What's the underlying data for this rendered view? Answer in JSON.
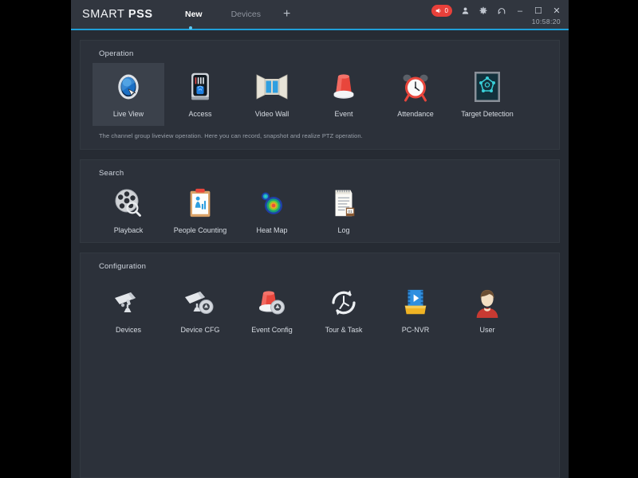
{
  "window": {
    "brand_thin": "SMART",
    "brand_bold": "PSS",
    "clock": "10:58:20",
    "alarm_count": "0",
    "icons": {
      "alarm": "speaker-alarm-icon",
      "user": "user-icon",
      "settings": "gear-icon",
      "help": "help-icon",
      "minimize": "minimize-icon",
      "maximize": "maximize-icon",
      "close": "close-icon"
    },
    "minimize_label": "–",
    "maximize_label": "☐",
    "close_label": "✕",
    "accent_color": "#1f9fd8"
  },
  "tabs": [
    {
      "label": "New",
      "active": true
    },
    {
      "label": "Devices",
      "active": false
    }
  ],
  "tab_add_label": "+",
  "panels": [
    {
      "title": "Operation",
      "description": "The channel group liveview operation. Here you can record, snapshot and realize PTZ operation.",
      "items": [
        {
          "label": "Live View",
          "icon": "dome-camera-icon",
          "selected": true
        },
        {
          "label": "Access",
          "icon": "access-terminal-icon",
          "selected": false
        },
        {
          "label": "Video Wall",
          "icon": "video-wall-icon",
          "selected": false
        },
        {
          "label": "Event",
          "icon": "siren-icon",
          "selected": false
        },
        {
          "label": "Attendance",
          "icon": "alarm-clock-icon",
          "selected": false
        },
        {
          "label": "Target Detection",
          "icon": "target-detection-icon",
          "selected": false
        }
      ]
    },
    {
      "title": "Search",
      "description": "",
      "items": [
        {
          "label": "Playback",
          "icon": "film-reel-search-icon",
          "selected": false
        },
        {
          "label": "People Counting",
          "icon": "clipboard-people-icon",
          "selected": false
        },
        {
          "label": "Heat Map",
          "icon": "heat-map-icon",
          "selected": false
        },
        {
          "label": "Log",
          "icon": "log-notepad-icon",
          "selected": false
        }
      ]
    },
    {
      "title": "Configuration",
      "description": "",
      "items": [
        {
          "label": "Devices",
          "icon": "bullet-camera-icon",
          "selected": false
        },
        {
          "label": "Device CFG",
          "icon": "camera-gear-icon",
          "selected": false
        },
        {
          "label": "Event Config",
          "icon": "siren-gear-icon",
          "selected": false
        },
        {
          "label": "Tour & Task",
          "icon": "clock-refresh-icon",
          "selected": false
        },
        {
          "label": "PC-NVR",
          "icon": "pc-nvr-icon",
          "selected": false
        },
        {
          "label": "User",
          "icon": "user-avatar-icon",
          "selected": false
        }
      ]
    }
  ]
}
